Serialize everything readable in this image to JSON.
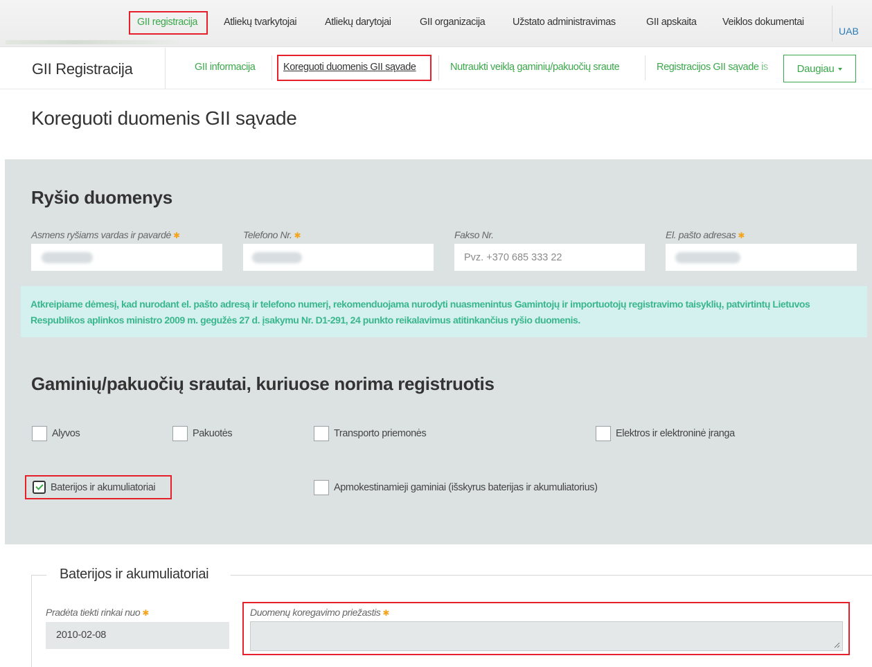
{
  "top_nav": {
    "items": [
      "GII registracija",
      "Atliekų tvarkytojai",
      "Atliekų darytojai",
      "GII organizacija",
      "Užstato administravimas",
      "GII apskaita",
      "Veiklos dokumentai"
    ],
    "active_index": 0,
    "user_label": "UAB"
  },
  "sub_nav": {
    "brand": "GII Registracija",
    "items": [
      "GII informacija",
      "Koreguoti duomenis GII sąvade",
      "Nutraukti veiklą gaminių/pakuočių sraute",
      "Registracijos GII sąvade is"
    ],
    "active_index": 1,
    "more_label": "Daugiau"
  },
  "page_title": "Koreguoti duomenis GII sąvade",
  "contact_section": {
    "title": "Ryšio duomenys",
    "fields": [
      {
        "label": "Asmens ryšiams vardas ir pavardė",
        "required": true,
        "value": "",
        "placeholder": ""
      },
      {
        "label": "Telefono Nr.",
        "required": true,
        "value": "",
        "placeholder": ""
      },
      {
        "label": "Fakso Nr.",
        "required": false,
        "value": "",
        "placeholder": "Pvz. +370 685 333 22"
      },
      {
        "label": "El. pašto adresas",
        "required": true,
        "value": "",
        "placeholder": ""
      }
    ],
    "required_mark": "✱"
  },
  "notice": "Atkreipiame dėmesį, kad nurodant el. pašto adresą ir telefono numerį, rekomenduojama nurodyti nuasmenintus Gamintojų ir importuotojų registravimo taisyklių, patvirtintų Lietuvos Respublikos aplinkos ministro 2009 m. gegužės 27 d. įsakymu Nr. D1-291, 24 punkto reikalavimus atitinkančius ryšio duomenis.",
  "streams_section": {
    "title": "Gaminių/pakuočių srautai, kuriuose norima registruotis",
    "options": [
      {
        "label": "Alyvos",
        "checked": false
      },
      {
        "label": "Pakuotės",
        "checked": false
      },
      {
        "label": "Transporto priemonės",
        "checked": false
      },
      {
        "label": "Elektros ir elektroninė įranga",
        "checked": false
      },
      {
        "label": "Baterijos ir akumuliatoriai",
        "checked": true
      },
      {
        "label": "Apmokestinamieji gaminiai (išskyrus baterijas ir akumuliatorius)",
        "checked": false
      }
    ]
  },
  "battery_section": {
    "title": "Baterijos ir akumuliatoriai",
    "start_label": "Pradėta tiekti rinkai nuo",
    "start_value": "2010-02-08",
    "reason_label": "Duomenų koregavimo priežastis",
    "reason_value": ""
  },
  "colors": {
    "accent_green": "#3aa84a",
    "highlight_red": "#e5202a",
    "panel_bg": "#dce2e2",
    "notice_bg": "#d4f1ef",
    "required_orange": "#f4a31c"
  }
}
